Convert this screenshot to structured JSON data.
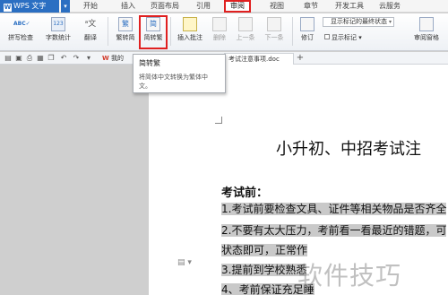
{
  "menubar": {
    "app_name": "WPS 文字",
    "tabs": [
      "开始",
      "插入",
      "页面布局",
      "引用",
      "审阅",
      "视图",
      "章节",
      "开发工具",
      "云服务"
    ],
    "active_tab": "审阅"
  },
  "ribbon": {
    "spell_check": "拼写检查",
    "word_count": "字数统计",
    "translate": "翻译",
    "trad_to_simp": "繁转简",
    "simp_to_trad": "简转繁",
    "insert_comment": "插入批注",
    "delete": "删除",
    "prev": "上一条",
    "next": "下一条",
    "revise": "修订",
    "show_markup_dropdown": "显示标记的最终状态",
    "show_markup": "显示标记",
    "review_pane": "审阅窗格"
  },
  "quickbar": {
    "doc_tab_1": "我的",
    "doc_tab_2": "考试注意事项.doc",
    "add_tab": "+"
  },
  "tooltip": {
    "title": "简转繁",
    "body": "将简体中文转换为繁体中文。"
  },
  "document": {
    "title": "小升初、中招考试注",
    "heading": "考试前：",
    "lines": [
      "1.考试前要检查文具、证件等相关物品是否齐全",
      "2.不要有太大压力，考前看一看最近的错题，可",
      "状态即可，正常作",
      "3.提前到学校熟悉",
      "4、考前保证充足睡"
    ]
  },
  "watermark": "软件技巧",
  "colors": {
    "accent": "#2b6fc2",
    "highlight_box": "#e02020",
    "text_highlight": "#c9c9c9"
  }
}
